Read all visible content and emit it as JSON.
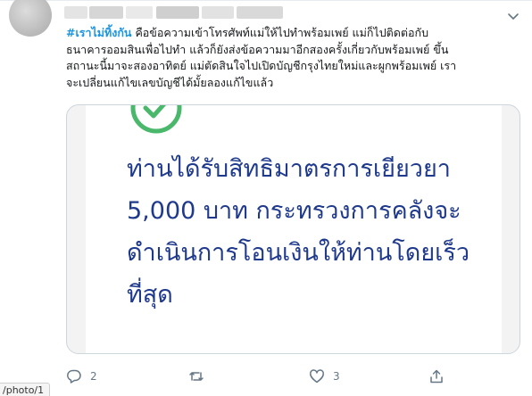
{
  "tweet": {
    "hashtag": "#เราไม่ทิ้งกัน",
    "text_lines": [
      " คือข้อความเข้าโทรศัพท์แม่ให้ไปทำพร้อมเพย์ แม่ก็ไปติดต่อกับ",
      "ธนาคารออมสินเพื่อไปทำ แล้วก็ยังส่งข้อความมาอีกสองครั้งเกี่ยวกับพร้อมเพย์ ขึ้น",
      "สถานะนี้มาจะสองอาทิตย์ แม่ตัดสินใจไปเปิดบัญชีกรุงไทยใหม่และผูกพร้อมเพย์ เรา",
      "จะเปลี่ยนแก้ไขเลขบัญชีได้มั้ยลองแก้ไขแล้ว"
    ],
    "media": {
      "lines": [
        "ท่านได้รับสิทธิมาตรการเยียวยา",
        "5,000 บาท กระทรวงการคลังจะ",
        "ดำเนินการโอนเงินให้ท่านโดยเร็ว",
        "ที่สุด"
      ],
      "text_color": "#1f3a8c",
      "check_color": "#49b86a"
    },
    "actions": {
      "reply_count": "2",
      "retweet_count": "",
      "like_count": "3",
      "share_count": ""
    }
  },
  "status_bar": {
    "url": "/photo/1"
  },
  "colors": {
    "accent": "#1b95e0",
    "icon_gray": "#657786"
  }
}
